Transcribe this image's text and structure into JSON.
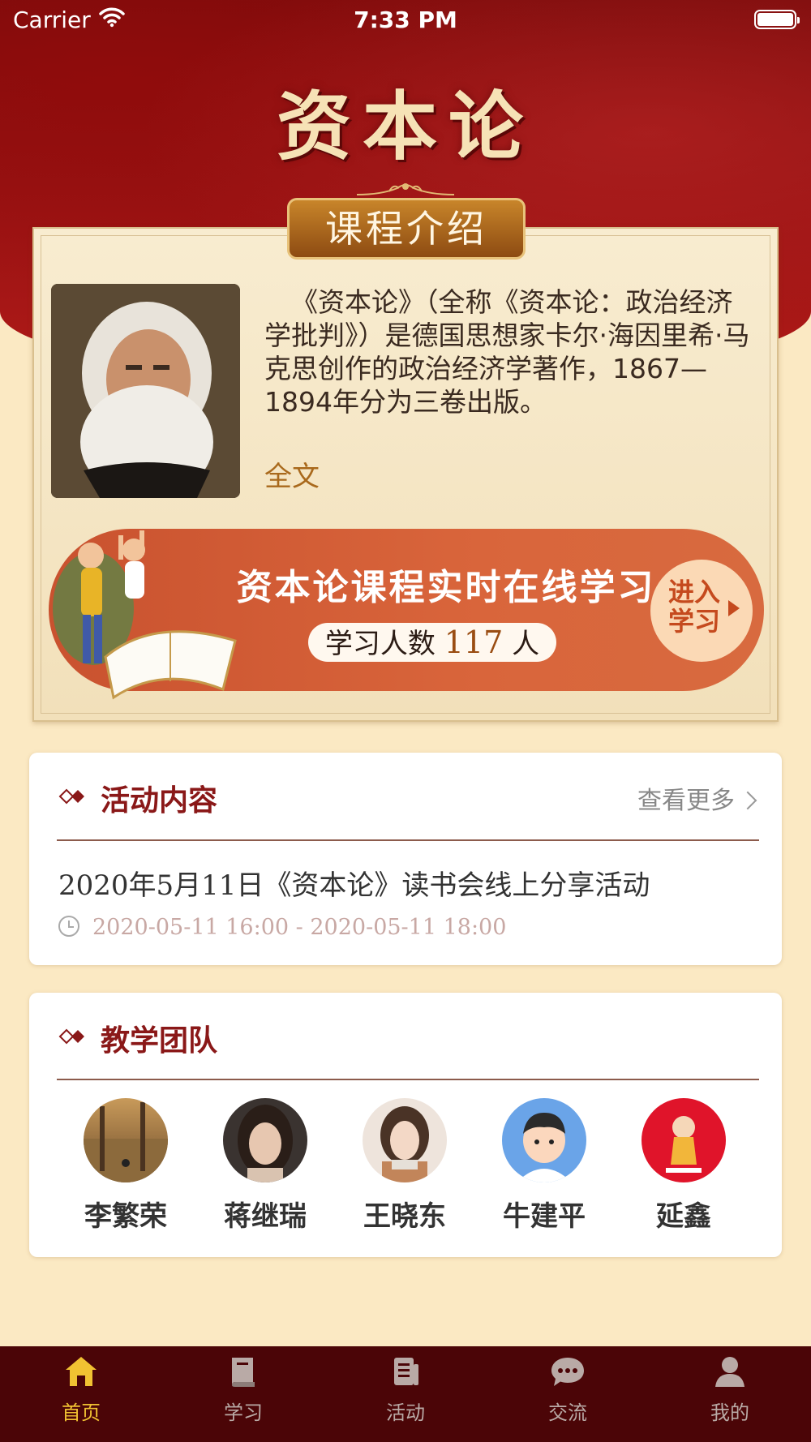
{
  "status_bar": {
    "carrier": "Carrier",
    "time": "7:33 PM"
  },
  "app": {
    "title": "资本论"
  },
  "intro": {
    "badge": "课程介绍",
    "description": "《资本论》（全称《资本论：政治经济学批判》）是德国思想家卡尔·海因里希·马克思创作的政治经济学著作，1867—1894年分为三卷出版。",
    "full_text_link": "全文"
  },
  "banner": {
    "title": "资本论课程实时在线学习",
    "count_prefix": "学习人数",
    "count": "117",
    "count_suffix": "人",
    "enter_line1": "进入",
    "enter_line2": "学习"
  },
  "activities": {
    "title": "活动内容",
    "more": "查看更多",
    "item": {
      "title": "2020年5月11日《资本论》读书会线上分享活动",
      "time": "2020-05-11 16:00 - 2020-05-11 18:00"
    }
  },
  "team": {
    "title": "教学团队",
    "members": [
      "李繁荣",
      "蒋继瑞",
      "王晓东",
      "牛建平",
      "延鑫"
    ]
  },
  "tabs": [
    {
      "label": "首页",
      "icon": "home-icon",
      "active": true
    },
    {
      "label": "学习",
      "icon": "book-icon",
      "active": false
    },
    {
      "label": "活动",
      "icon": "activity-icon",
      "active": false
    },
    {
      "label": "交流",
      "icon": "chat-icon",
      "active": false
    },
    {
      "label": "我的",
      "icon": "user-icon",
      "active": false
    }
  ],
  "colors": {
    "accent": "#8a1818",
    "tab_active": "#f1c232",
    "tab_bar": "#4b0507",
    "banner": "#d9653b"
  }
}
